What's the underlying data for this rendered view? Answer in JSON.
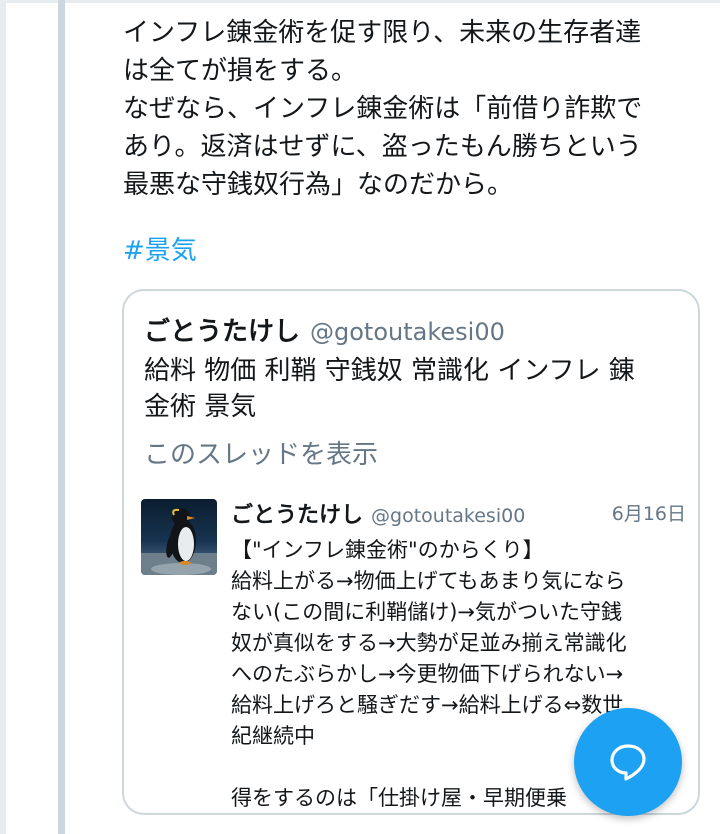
{
  "tweet": {
    "lines": [
      "インフレ錬金術を促す限り、未来の生存者達",
      "は全てが損をする。",
      "なぜなら、インフレ錬金術は「前借り詐欺で",
      "あり。返済はせずに、盗ったもん勝ちという",
      "最悪な守銭奴行為」なのだから。"
    ],
    "hashtag": "#景気"
  },
  "quote": {
    "name": "ごとうたけし",
    "handle": "@gotoutakesi00",
    "text_lines": [
      "給料 物価 利鞘 守銭奴 常識化 インフレ 錬",
      "金術 景気"
    ],
    "show_thread": "このスレッドを表示",
    "inner": {
      "name": "ごとうたけし",
      "handle": "@gotoutakesi00",
      "date": "6月16日",
      "text_lines": [
        "【\"インフレ錬金術\"のからくり】",
        "給料上がる→物価上げてもあまり気になら",
        "ない(この間に利鞘儲け)→気がついた守銭",
        "奴が真似をする→大勢が足並み揃え常識化",
        "へのたぶらかし→今更物価下げられない→",
        "給料上げろと騒ぎだす→給料上げる⇔数世",
        "紀継続中",
        "",
        "得をするのは「仕掛け屋・早期便乗"
      ]
    }
  },
  "fab": {
    "icon": "compose-reply-icon"
  },
  "colors": {
    "link": "#1da1f2",
    "secondary_text": "#657786",
    "border": "#ccd6dd"
  }
}
